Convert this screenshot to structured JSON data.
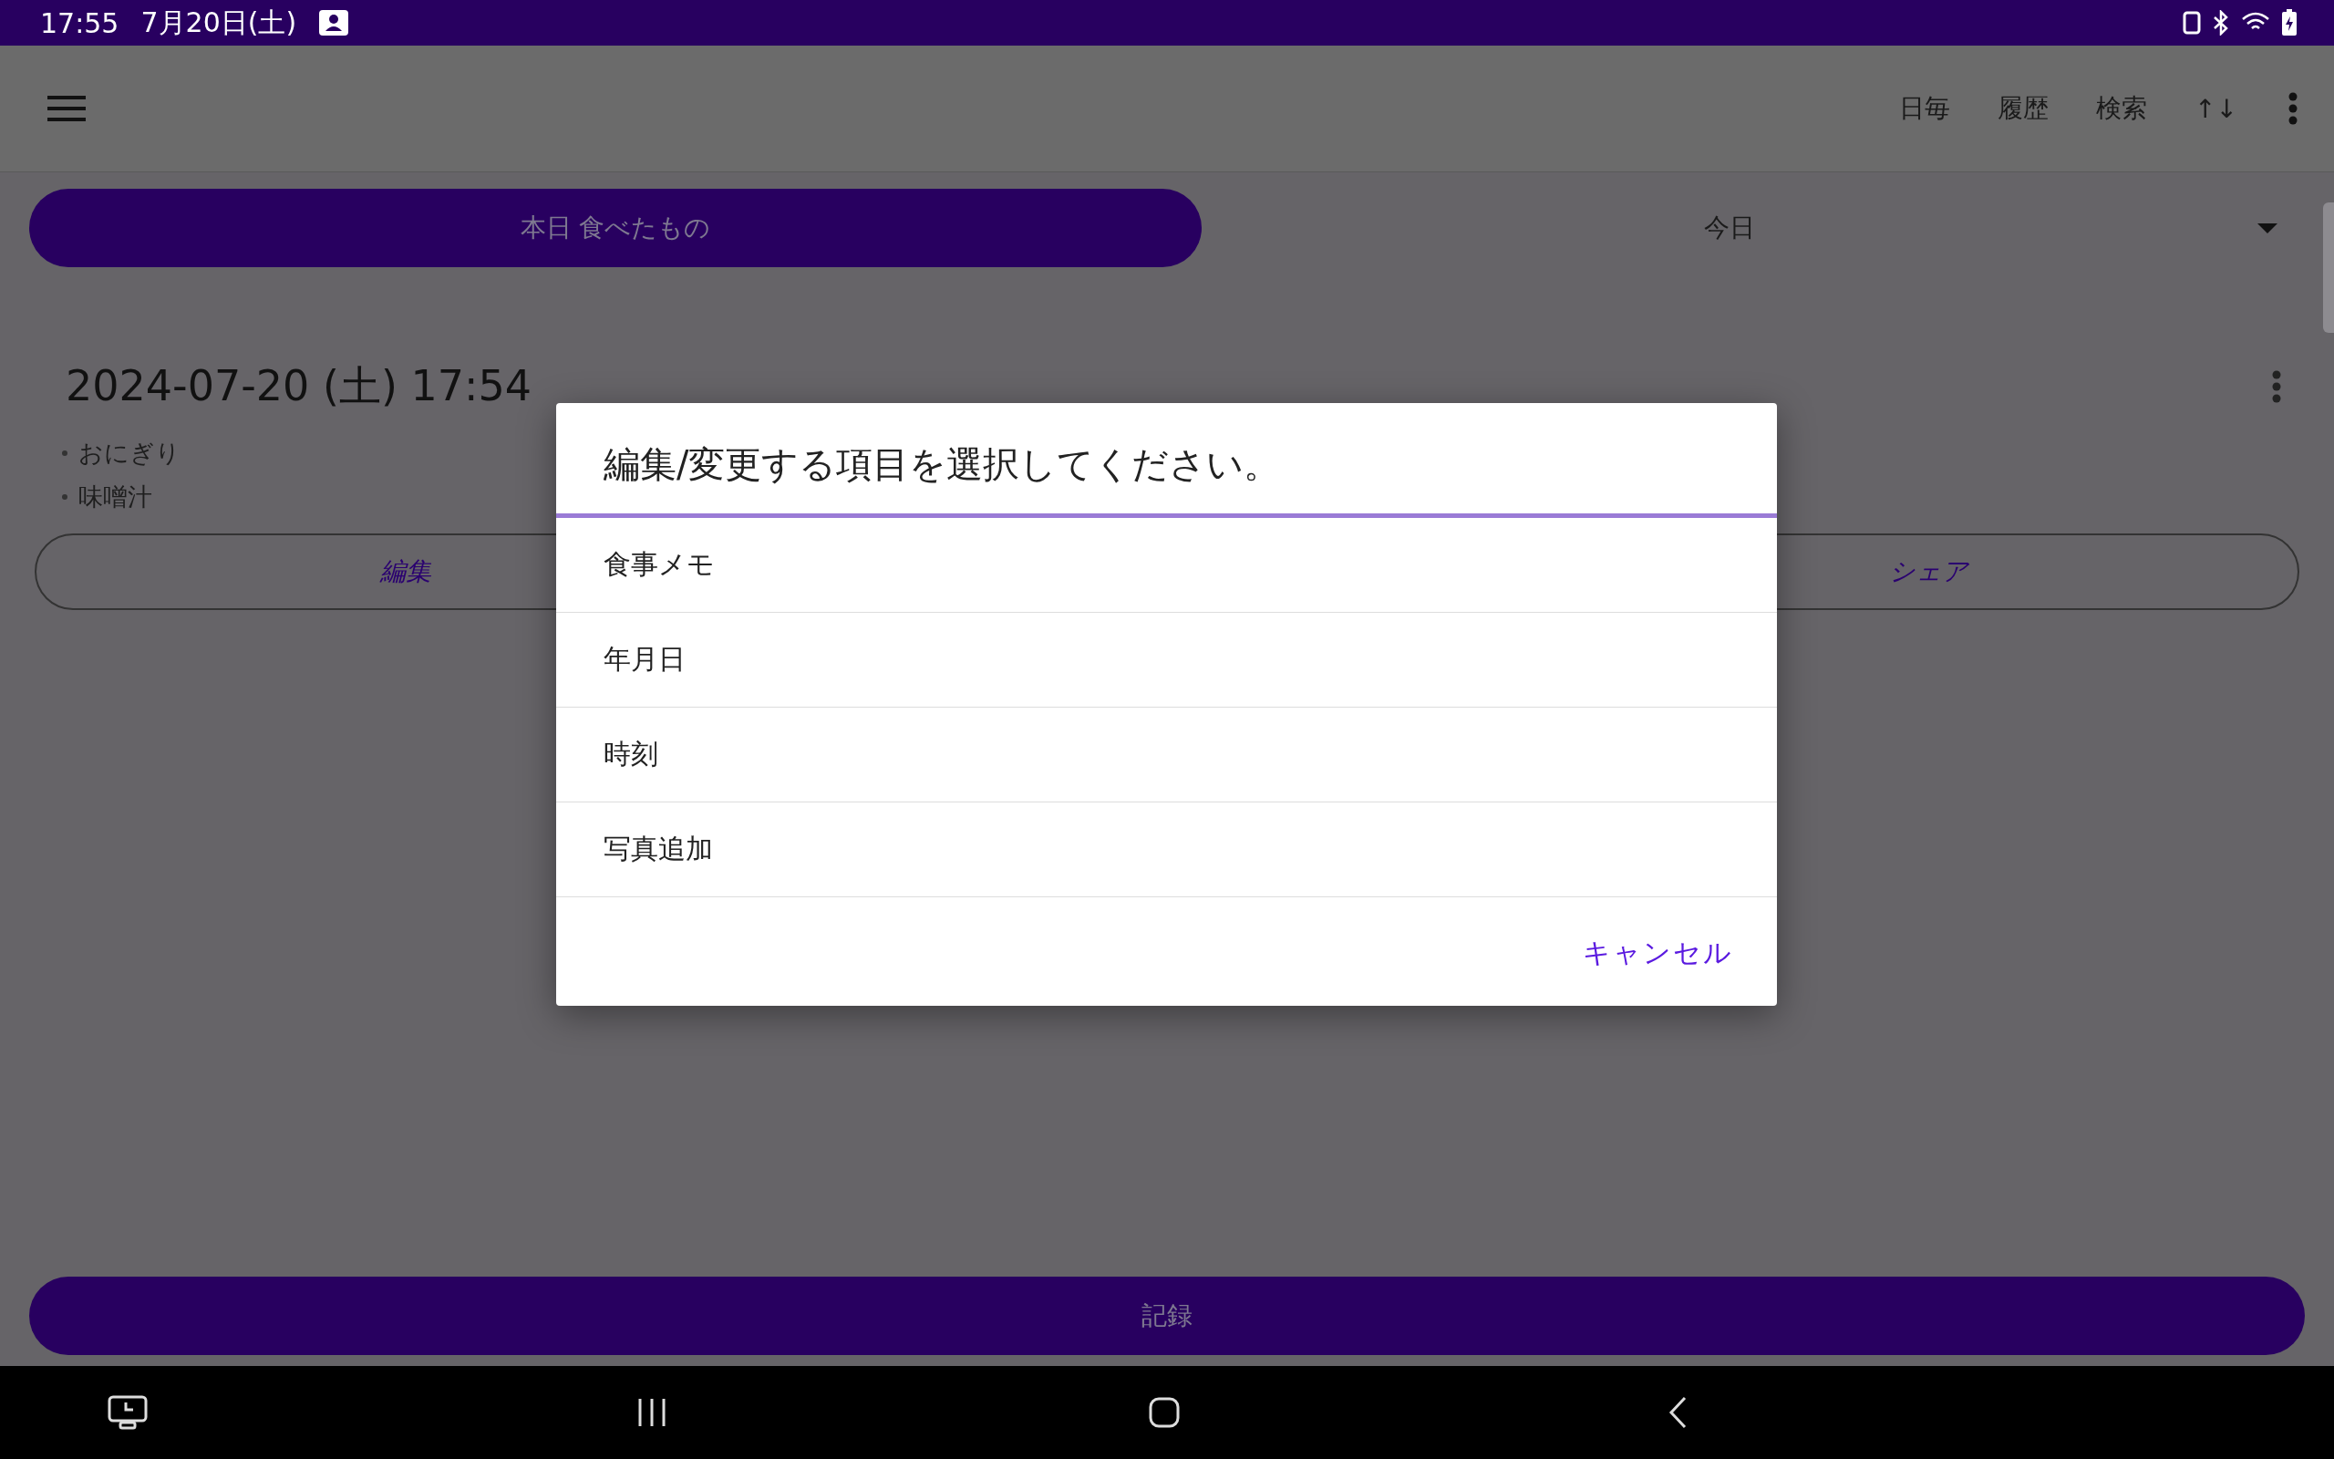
{
  "status_bar": {
    "time": "17:55",
    "date": "7月20日(土)"
  },
  "toolbar": {
    "actions": [
      "日毎",
      "履歴",
      "検索",
      "↑↓"
    ]
  },
  "header": {
    "today_button": "本日 食べたもの",
    "period_dropdown": {
      "value": "今日"
    }
  },
  "entry": {
    "datetime": "2024-07-20 (土) 17:54",
    "foods": [
      "おにぎり",
      "味噌汁"
    ],
    "buttons": [
      "編集",
      "シェア"
    ]
  },
  "record_button": "記録",
  "dialog": {
    "title": "編集/変更する項目を選択してください。",
    "options": [
      "食事メモ",
      "年月日",
      "時刻",
      "写真追加"
    ],
    "cancel": "キャンセル"
  }
}
